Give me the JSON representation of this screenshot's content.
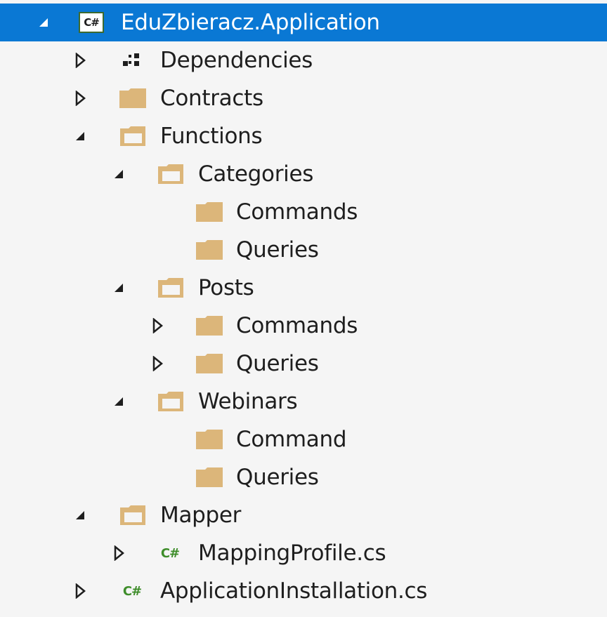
{
  "colors": {
    "selection": "#0a78d4",
    "folder": "#dcb67a",
    "csharp_green": "#3e8d2a",
    "background": "#f5f5f5"
  },
  "tree": {
    "project": {
      "label": "EduZbieracz.Application",
      "icon": "csharp-project-icon",
      "expanded": true,
      "selected": true
    },
    "dependencies": {
      "label": "Dependencies",
      "icon": "dependencies-icon",
      "expanded": false
    },
    "contracts": {
      "label": "Contracts",
      "icon": "folder-closed-icon",
      "expanded": false
    },
    "functions": {
      "label": "Functions",
      "icon": "folder-open-icon",
      "expanded": true
    },
    "categories": {
      "label": "Categories",
      "icon": "folder-open-icon",
      "expanded": true
    },
    "categories_commands": {
      "label": "Commands",
      "icon": "folder-closed-icon"
    },
    "categories_queries": {
      "label": "Queries",
      "icon": "folder-closed-icon"
    },
    "posts": {
      "label": "Posts",
      "icon": "folder-open-icon",
      "expanded": true
    },
    "posts_commands": {
      "label": "Commands",
      "icon": "folder-closed-icon",
      "expanded": false
    },
    "posts_queries": {
      "label": "Queries",
      "icon": "folder-closed-icon",
      "expanded": false
    },
    "webinars": {
      "label": "Webinars",
      "icon": "folder-open-icon",
      "expanded": true
    },
    "webinars_command": {
      "label": "Command",
      "icon": "folder-closed-icon"
    },
    "webinars_queries": {
      "label": "Queries",
      "icon": "folder-closed-icon"
    },
    "mapper": {
      "label": "Mapper",
      "icon": "folder-open-icon",
      "expanded": true
    },
    "mapping_profile": {
      "label": "MappingProfile.cs",
      "icon": "csharp-file-icon",
      "expanded": false
    },
    "application_installation": {
      "label": "ApplicationInstallation.cs",
      "icon": "csharp-file-icon",
      "expanded": false
    }
  },
  "icon_text": {
    "csharp_box": "C#",
    "csharp_file": "C#"
  }
}
